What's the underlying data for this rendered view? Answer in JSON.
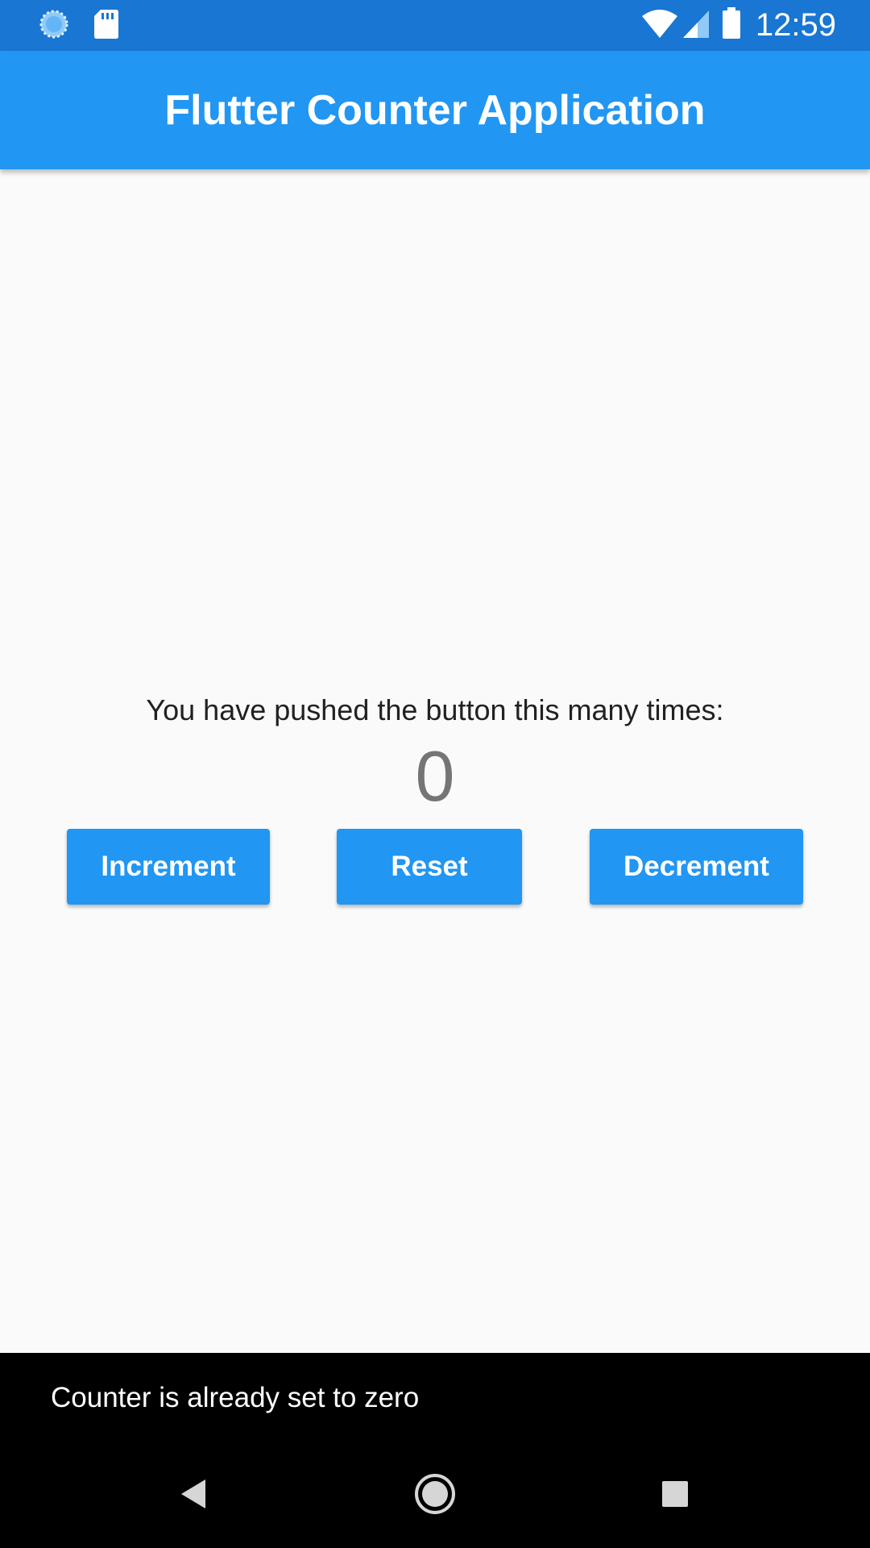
{
  "status_bar": {
    "time": "12:59",
    "icons": [
      "loading-circle-icon",
      "sd-card-icon",
      "wifi-icon",
      "cell-signal-icon",
      "battery-icon"
    ],
    "background": "#1976d2"
  },
  "app_bar": {
    "title": "Flutter Counter Application",
    "background": "#2196f3"
  },
  "main": {
    "message": "You have pushed the button this many times:",
    "counter": "0",
    "buttons": {
      "increment_label": "Increment",
      "reset_label": "Reset",
      "decrement_label": "Decrement"
    },
    "button_color": "#2196f3"
  },
  "snackbar": {
    "message": "Counter is already set to zero"
  },
  "nav_bar": {
    "icons": [
      "back-icon",
      "home-icon",
      "recents-icon"
    ]
  }
}
